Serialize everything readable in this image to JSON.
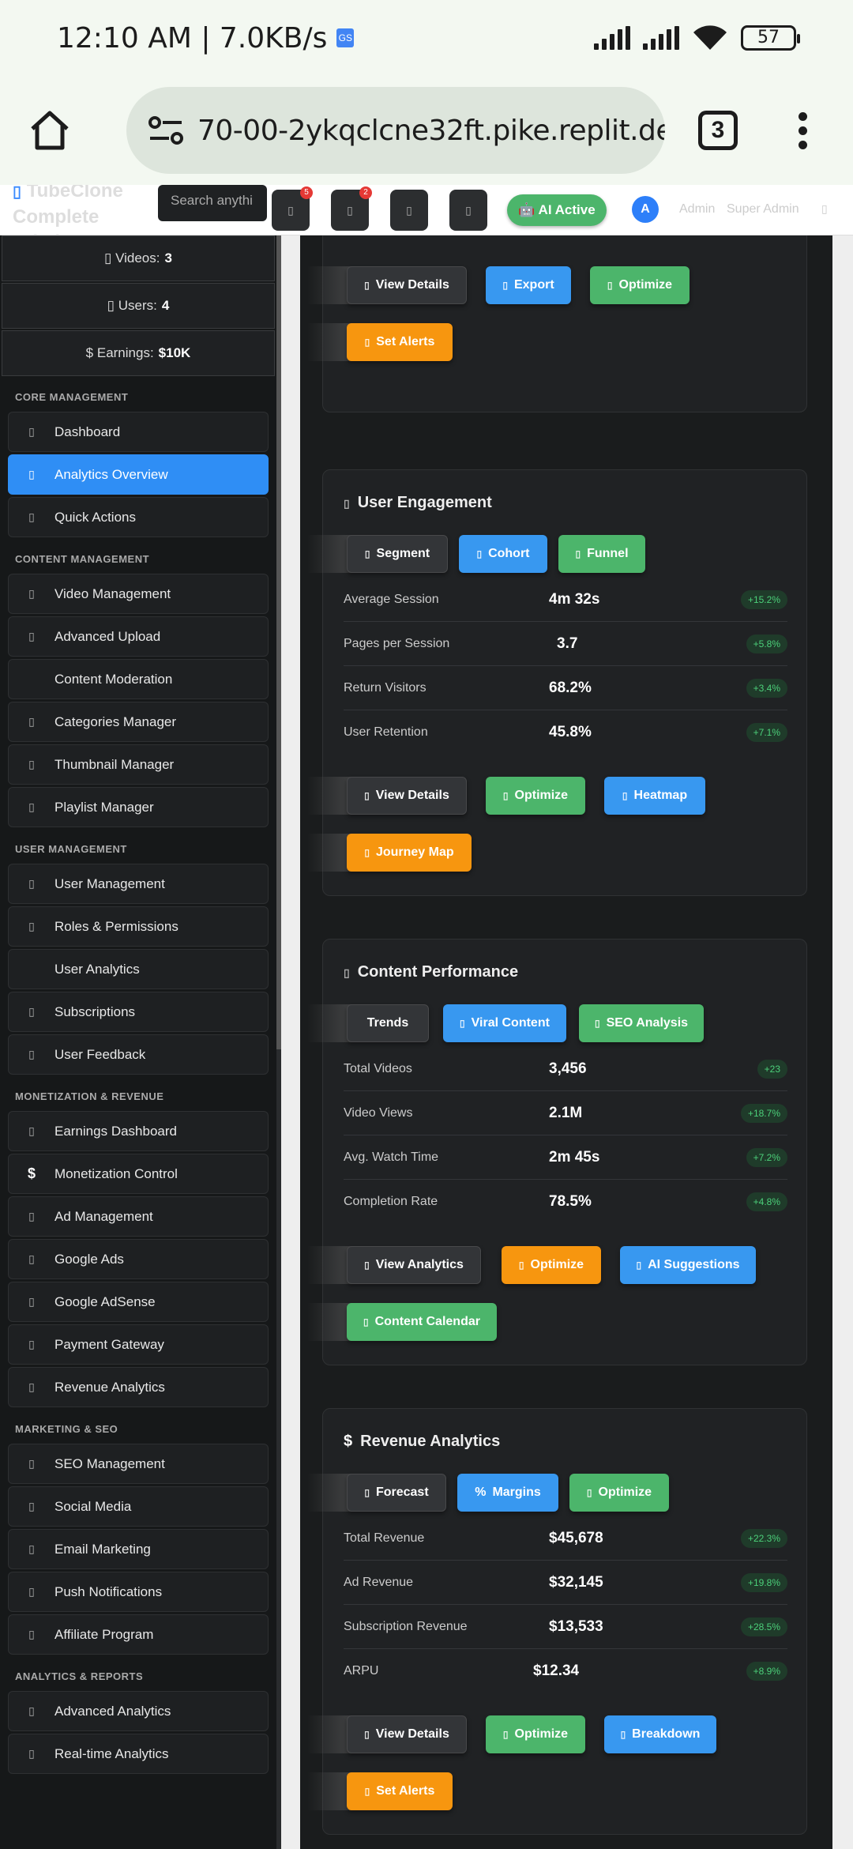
{
  "status": {
    "time": "12:10 AM | 7.0KB/s",
    "gs_icon": "GS",
    "battery": "57"
  },
  "browser": {
    "url": "70-00-2ykqclcne32ft.pike.replit.dev",
    "tab_count": "3"
  },
  "header": {
    "brand": "TubeClone Complete Admin",
    "brand_icon": "▯",
    "search_placeholder": "Search anythi",
    "icon_glyph": "▯",
    "badge1": "5",
    "badge2": "2",
    "ai_active": "🤖 AI Active",
    "avatar": "A",
    "admin": "Admin",
    "super_admin": "Super Admin",
    "caret": "▯"
  },
  "sidebar": {
    "stats": [
      {
        "label": "▯ Videos:",
        "value": "3"
      },
      {
        "label": "▯ Users:",
        "value": "4"
      },
      {
        "label": "$ Earnings:",
        "value": "$10K"
      }
    ],
    "sections": [
      {
        "title": "CORE MANAGEMENT",
        "items": [
          {
            "icon": "▯",
            "label": "Dashboard"
          },
          {
            "icon": "▯",
            "label": "Analytics Overview"
          },
          {
            "icon": "▯",
            "label": "Quick Actions"
          }
        ]
      },
      {
        "title": "CONTENT MANAGEMENT",
        "items": [
          {
            "icon": "▯",
            "label": "Video Management"
          },
          {
            "icon": "▯",
            "label": "Advanced Upload"
          },
          {
            "icon": "",
            "label": "Content Moderation"
          },
          {
            "icon": "▯",
            "label": "Categories Manager"
          },
          {
            "icon": "▯",
            "label": "Thumbnail Manager"
          },
          {
            "icon": "▯",
            "label": "Playlist Manager"
          }
        ]
      },
      {
        "title": "USER MANAGEMENT",
        "items": [
          {
            "icon": "▯",
            "label": "User Management"
          },
          {
            "icon": "▯",
            "label": "Roles & Permissions"
          },
          {
            "icon": "",
            "label": "User Analytics"
          },
          {
            "icon": "▯",
            "label": "Subscriptions"
          },
          {
            "icon": "▯",
            "label": "User Feedback"
          }
        ]
      },
      {
        "title": "MONETIZATION & REVENUE",
        "items": [
          {
            "icon": "▯",
            "label": "Earnings Dashboard"
          },
          {
            "icon": "$",
            "label": "Monetization Control"
          },
          {
            "icon": "▯",
            "label": "Ad Management"
          },
          {
            "icon": "▯",
            "label": "Google Ads"
          },
          {
            "icon": "▯",
            "label": "Google AdSense"
          },
          {
            "icon": "▯",
            "label": "Payment Gateway"
          },
          {
            "icon": "▯",
            "label": "Revenue Analytics"
          }
        ]
      },
      {
        "title": "MARKETING & SEO",
        "items": [
          {
            "icon": "▯",
            "label": "SEO Management"
          },
          {
            "icon": "▯",
            "label": "Social Media"
          },
          {
            "icon": "▯",
            "label": "Email Marketing"
          },
          {
            "icon": "▯",
            "label": "Push Notifications"
          },
          {
            "icon": "▯",
            "label": "Affiliate Program"
          }
        ]
      },
      {
        "title": "ANALYTICS & REPORTS",
        "items": [
          {
            "icon": "▯",
            "label": "Advanced Analytics"
          },
          {
            "icon": "▯",
            "label": "Real-time Analytics"
          }
        ]
      }
    ]
  },
  "cards": {
    "top": {
      "btn1": "View Details",
      "btn2": "Export",
      "btn3": "Optimize",
      "btn4": "Set Alerts"
    },
    "engagement": {
      "title": "User Engagement",
      "tags": [
        "Segment",
        "Cohort",
        "Funnel"
      ],
      "rows": [
        {
          "label": "Average Session",
          "value": "4m 32s",
          "change": "+15.2%"
        },
        {
          "label": "Pages per Session",
          "value": "3.7",
          "change": "+5.8%"
        },
        {
          "label": "Return Visitors",
          "value": "68.2%",
          "change": "+3.4%"
        },
        {
          "label": "User Retention",
          "value": "45.8%",
          "change": "+7.1%"
        }
      ],
      "actions": [
        "View Details",
        "Optimize",
        "Heatmap",
        "Journey Map"
      ]
    },
    "content": {
      "title": "Content Performance",
      "tags": [
        "Trends",
        "Viral Content",
        "SEO Analysis"
      ],
      "rows": [
        {
          "label": "Total Videos",
          "value": "3,456",
          "change": "+23"
        },
        {
          "label": "Video Views",
          "value": "2.1M",
          "change": "+18.7%"
        },
        {
          "label": "Avg. Watch Time",
          "value": "2m 45s",
          "change": "+7.2%"
        },
        {
          "label": "Completion Rate",
          "value": "78.5%",
          "change": "+4.8%"
        }
      ],
      "actions": [
        "View Analytics",
        "Optimize",
        "AI Suggestions",
        "Content Calendar"
      ]
    },
    "revenue": {
      "title": "Revenue Analytics",
      "title_icon": "$",
      "tags": [
        "Forecast",
        "Margins",
        "Optimize"
      ],
      "margins_icon": "%",
      "rows": [
        {
          "label": "Total Revenue",
          "value": "$45,678",
          "change": "+22.3%"
        },
        {
          "label": "Ad Revenue",
          "value": "$32,145",
          "change": "+19.8%"
        },
        {
          "label": "Subscription Revenue",
          "value": "$13,533",
          "change": "+28.5%"
        },
        {
          "label": "ARPU",
          "value": "$12.34",
          "change": "+8.9%"
        }
      ],
      "actions": [
        "View Details",
        "Optimize",
        "Breakdown",
        "Set Alerts"
      ]
    }
  }
}
